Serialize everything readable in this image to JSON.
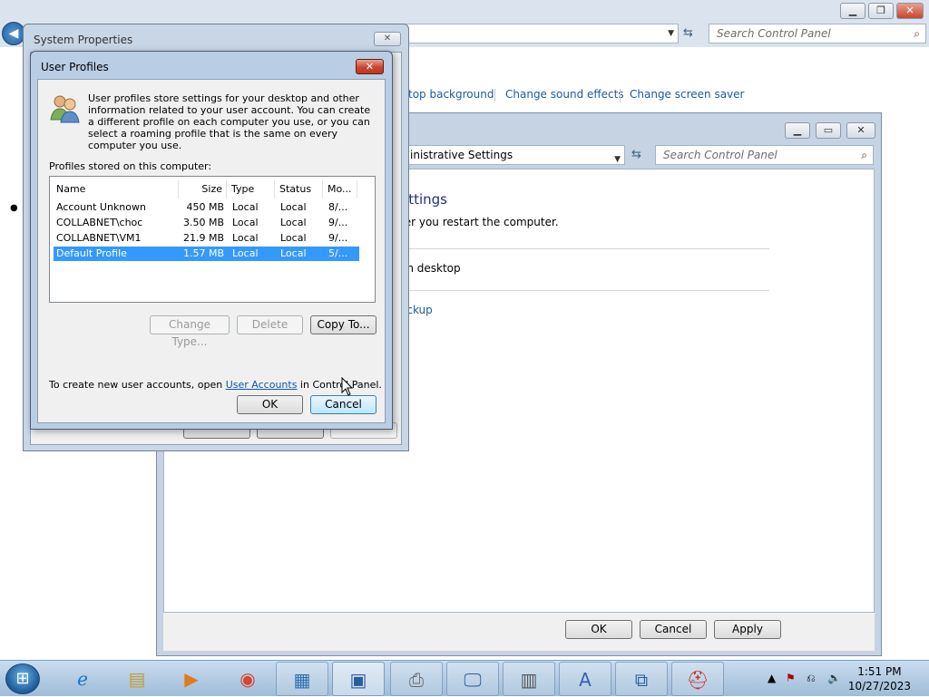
{
  "control_panel": {
    "search_placeholder": "Search Control Panel",
    "links": [
      "top background",
      "Change sound effects",
      "Change screen saver"
    ],
    "window_buttons": {
      "minimize": "▁",
      "restore": "❐",
      "close": "✕"
    }
  },
  "mid_window": {
    "address": "inistrative Settings",
    "search_placeholder": "Search Control Panel",
    "heading": "ettings",
    "restart_text": "ter you restart the computer.",
    "desktop_text": "on desktop",
    "backup_link": "ackup",
    "buttons": {
      "ok": "OK",
      "cancel": "Cancel",
      "apply": "Apply"
    },
    "window_buttons": {
      "minimize": "▁",
      "restore": "▭",
      "close": "✕"
    }
  },
  "system_properties": {
    "title": "System Properties",
    "close": "✕"
  },
  "user_profiles": {
    "title": "User Profiles",
    "close": "✕",
    "description": "User profiles store settings for your desktop and other information related to your user account. You can create a different profile on each computer you use, or you can select a roaming profile that is the same on every computer you use.",
    "list_label": "Profiles stored on this computer:",
    "columns": [
      "Name",
      "Size",
      "Type",
      "Status",
      "Mo..."
    ],
    "rows": [
      {
        "name": "Account Unknown",
        "size": "450 MB",
        "type": "Local",
        "status": "Local",
        "modified": "8/..."
      },
      {
        "name": "COLLABNET\\choc",
        "size": "3.50 MB",
        "type": "Local",
        "status": "Local",
        "modified": "9/..."
      },
      {
        "name": "COLLABNET\\VM1",
        "size": "21.9 MB",
        "type": "Local",
        "status": "Local",
        "modified": "9/..."
      },
      {
        "name": "Default Profile",
        "size": "1.57 MB",
        "type": "Local",
        "status": "Local",
        "modified": "5/..."
      }
    ],
    "buttons": {
      "change_type": "Change Type...",
      "delete": "Delete",
      "copy_to": "Copy To...",
      "ok": "OK",
      "cancel": "Cancel"
    },
    "create_text_prefix": "To create new user accounts, open ",
    "create_link": "User Accounts",
    "create_text_suffix": " in Control Panel."
  },
  "taskbar": {
    "time": "1:51 PM",
    "date": "10/27/2023",
    "items": [
      "ie-icon",
      "explorer-icon",
      "media-player-icon",
      "chrome-icon",
      "control-panel-icon",
      "system-icon",
      "printers-icon",
      "computer-icon",
      "server-icon",
      "text-editor-icon",
      "remote-desktop-icon",
      "toolbox-icon"
    ]
  }
}
